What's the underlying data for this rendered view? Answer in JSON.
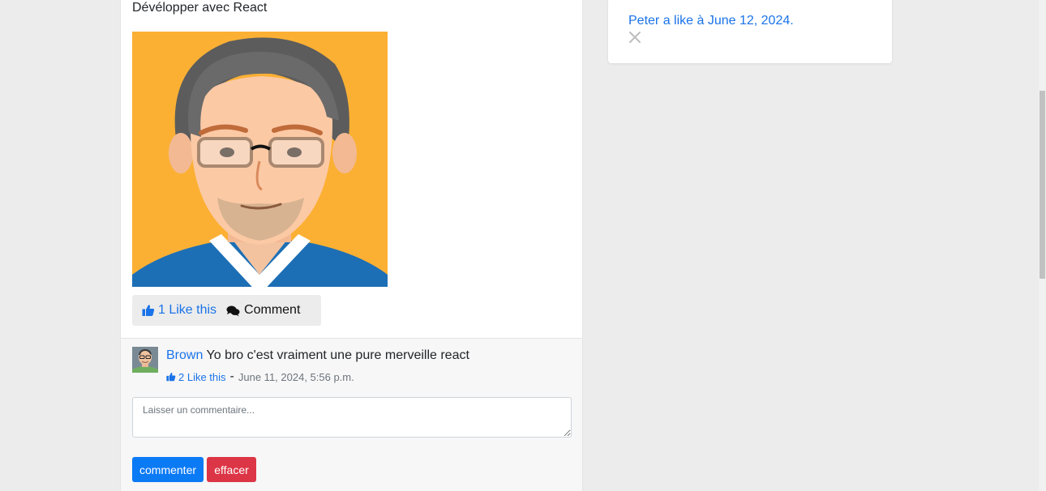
{
  "post": {
    "title": "Dévélopper avec React",
    "like_label": "1 Like this",
    "comment_label": "Comment"
  },
  "comment": {
    "author": "Brown",
    "text": "Yo bro c'est vraiment une pure merveille react",
    "like_label": "2 Like this",
    "separator": "-",
    "date": "June 11, 2024, 5:56 p.m."
  },
  "comment_form": {
    "placeholder": "Laisser un commentaire...",
    "submit_label": "commenter",
    "clear_label": "effacer"
  },
  "notification": {
    "text": "Peter a like à June 12, 2024."
  },
  "colors": {
    "link": "#1a73e8",
    "primary": "#0b7af5",
    "danger": "#dc3545",
    "avatar_bg": "#fbb034"
  },
  "icons": {
    "like": "thumbs-up-icon",
    "comment": "comments-icon",
    "close": "close-icon"
  }
}
